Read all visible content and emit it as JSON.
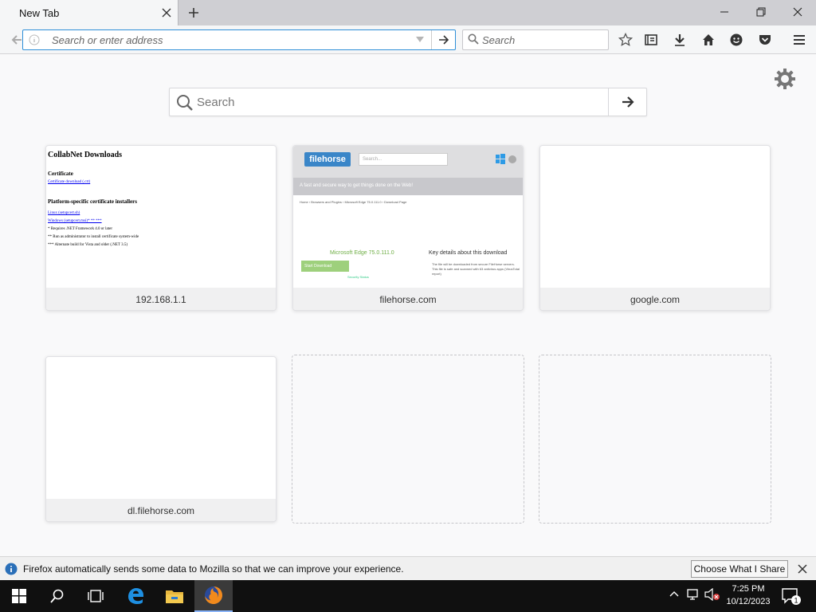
{
  "tab": {
    "title": "New Tab"
  },
  "navbar": {
    "url_placeholder": "Search or enter address",
    "search_placeholder": "Search"
  },
  "content": {
    "search_placeholder": "Search",
    "tiles": [
      {
        "label": "192.168.1.1"
      },
      {
        "label": "filehorse.com"
      },
      {
        "label": "google.com"
      },
      {
        "label": "dl.filehorse.com"
      }
    ],
    "thumb1": {
      "heading": "CollabNet Downloads",
      "section1": "Certificate",
      "link1": "Certificate download (.crt)",
      "section2": "Platform-specific certificate installers",
      "link2": "Linux (setupcert.sh)",
      "link3": "Windows (setupcert.msi)* ** ***",
      "note1": "* Requires .NET Framework 4.0 or later",
      "note2": "** Run as administrator to install certificate system-wide",
      "note3": "*** Alternate build for Vista and older (.NET 3.5)"
    },
    "thumb2": {
      "logo": "filehorse",
      "search": "Search...",
      "tagline": "A fast and secure way to get things done on the Web!",
      "crumb": "Home › Browsers and Plugins › Microsoft Edge 75.0.111.0 › Download Page",
      "product": "Microsoft Edge 75.0.111.0",
      "download": "Start Download",
      "safe": "Security Status",
      "key": "Key details about this download",
      "key_text": "The file will be downloaded from secure FileHorse servers. This file is safe and scanned with 63 antivirus apps (VirusTotal report)"
    }
  },
  "notification": {
    "message": "Firefox automatically sends some data to Mozilla so that we can improve your experience.",
    "button": "Choose What I Share"
  },
  "taskbar": {
    "time": "7:25 PM",
    "date": "10/12/2023",
    "notification_count": "1"
  }
}
